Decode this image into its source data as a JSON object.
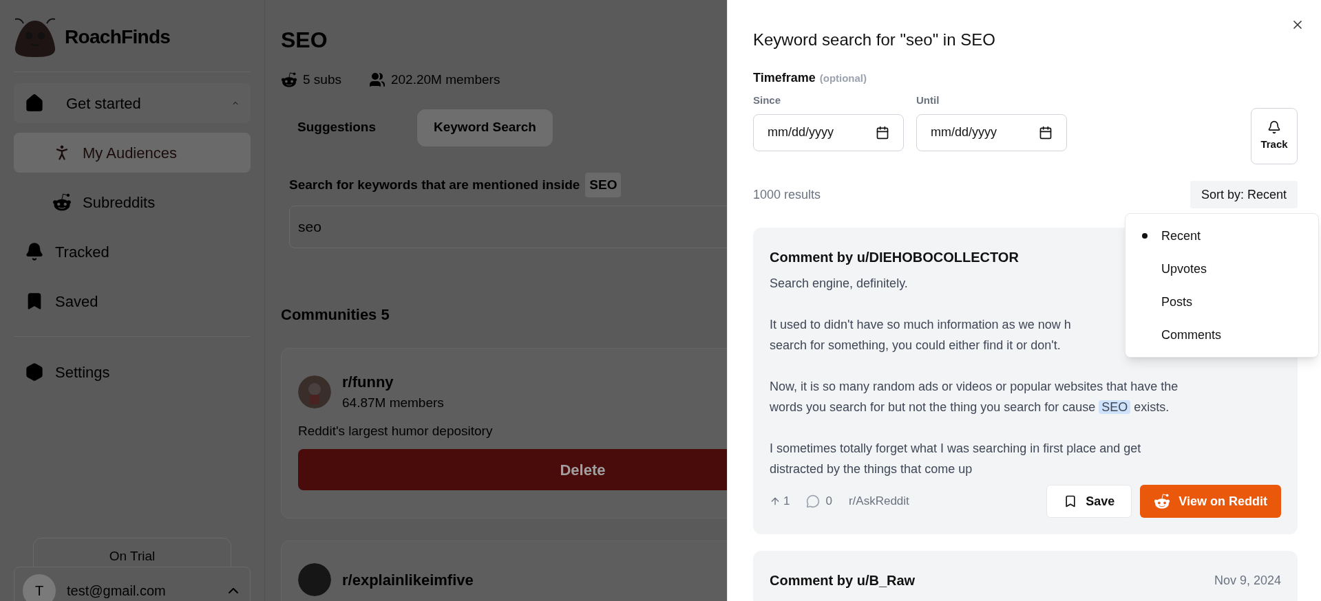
{
  "sidebar": {
    "brand": "RoachFinds",
    "nav": [
      {
        "kind": "group",
        "label": "Get started",
        "expanded": true,
        "selected": false
      },
      {
        "kind": "child",
        "label": "My Audiences",
        "selected": true
      },
      {
        "kind": "child",
        "label": "Subreddits",
        "selected": false
      },
      {
        "kind": "item",
        "label": "Tracked",
        "selected": false
      },
      {
        "kind": "item",
        "label": "Saved",
        "selected": false
      },
      {
        "kind": "divider"
      },
      {
        "kind": "item",
        "label": "Settings",
        "selected": false
      }
    ],
    "trial_button": "On Trial",
    "user": {
      "initial": "T",
      "email": "test@gmail.com"
    }
  },
  "main": {
    "title": "SEO",
    "stats": [
      "5 subs",
      "202.20M members"
    ],
    "tabs": [
      {
        "label": "Suggestions",
        "selected": false
      },
      {
        "label": "Keyword Search",
        "selected": true
      }
    ],
    "search_label": "Search for keywords that are mentioned inside",
    "search_tag": "SEO",
    "search_value": "seo",
    "communities_heading": "Communities 5",
    "communities": [
      {
        "name": "r/funny",
        "members": "64.87M members",
        "description": "Reddit's largest humor depository",
        "button": "Delete"
      },
      {
        "name": "r/explainlikeimfive"
      }
    ]
  },
  "panel": {
    "title": "Keyword search for \"seo\" in SEO",
    "timeframe_label": "Timeframe",
    "timeframe_hint": "(optional)",
    "since_label": "Since",
    "until_label": "Until",
    "since_placeholder": "mm/dd/yyyy",
    "until_placeholder": "mm/dd/yyyy",
    "track_button": "Track",
    "results_count": "1000 results",
    "sort_button": "Sort by: Recent",
    "sort_menu": [
      {
        "label": "Recent",
        "selected": true
      },
      {
        "label": "Upvotes",
        "selected": false
      },
      {
        "label": "Posts",
        "selected": false
      },
      {
        "label": "Comments",
        "selected": false
      }
    ],
    "results": [
      {
        "title": "Comment by u/DIEHOBOCOLLECTOR",
        "paragraphs": [
          [
            [
              {
                "text": "Search engine, definitely.",
                "highlight": false
              }
            ]
          ],
          [
            [
              {
                "text": "It used to didn't have so much information as we now h",
                "highlight": false
              }
            ],
            [
              {
                "text": "search for something, you could either find it or don't.",
                "highlight": false
              }
            ]
          ],
          [
            [
              {
                "text": "Now, it is so many random ads or videos or popular websites that have the words you search for but not the thing you search for cause ",
                "highlight": false
              },
              {
                "text": "SEO",
                "highlight": true
              },
              {
                "text": " exists.",
                "highlight": false
              }
            ]
          ],
          [
            [
              {
                "text": "I sometimes totally forget what I was searching in first place and get distracted by the things that come up",
                "highlight": false
              }
            ]
          ]
        ],
        "upvotes": "1",
        "comments": "0",
        "subreddit": "r/AskReddit",
        "save_button": "Save",
        "view_button": "View on Reddit"
      },
      {
        "title": "Comment by u/B_Raw",
        "date": "Nov 9, 2024"
      }
    ]
  }
}
